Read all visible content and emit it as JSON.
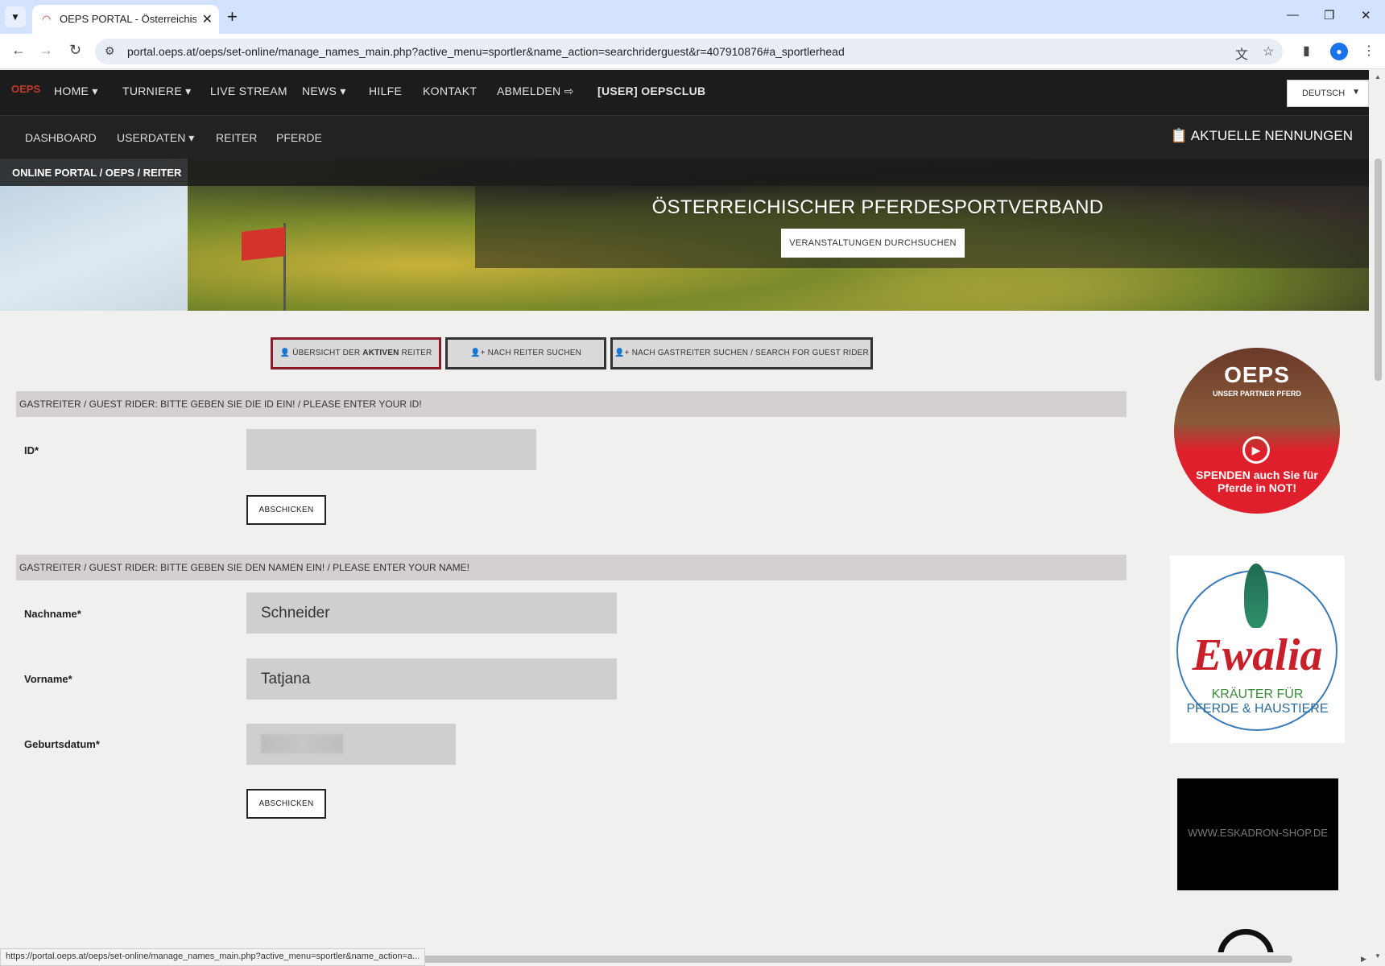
{
  "browser": {
    "tab_title": "OEPS PORTAL - Österreichische",
    "url": "portal.oeps.at/oeps/set-online/manage_names_main.php?active_menu=sportler&name_action=searchriderguest&r=407910876#a_sportlerhead",
    "status_url": "https://portal.oeps.at/oeps/set-online/manage_names_main.php?active_menu=sportler&name_action=a..."
  },
  "topnav": {
    "logo": "OEPS",
    "items": [
      "HOME ▾",
      "TURNIERE ▾",
      "LIVE STREAM",
      "NEWS ▾",
      "HILFE",
      "KONTAKT",
      "ABMELDEN ⇨",
      "[USER] OEPSCLUB"
    ],
    "language": "DEUTSCH"
  },
  "subnav": {
    "items": [
      "DASHBOARD",
      "USERDATEN ▾",
      "REITER",
      "PFERDE"
    ],
    "nennungen": "AKTUELLE NENNUNGEN"
  },
  "breadcrumb": "ONLINE PORTAL  /  OEPS  /  REITER",
  "hero": {
    "title": "ÖSTERREICHISCHER PFERDESPORTVERBAND",
    "button": "VERANSTALTUNGEN DURCHSUCHEN"
  },
  "actions": {
    "overview_prefix": "ÜBERSICHT DER ",
    "overview_bold": "AKTIVEN",
    "overview_suffix": " REITER",
    "search_rider": "NACH REITER SUCHEN",
    "search_guest": "NACH GASTREITER SUCHEN / SEARCH FOR GUEST RIDER"
  },
  "form_id": {
    "heading": "GASTREITER / GUEST RIDER: BITTE GEBEN SIE DIE ID EIN! / PLEASE ENTER YOUR ID!",
    "label": "ID*",
    "value": "",
    "submit": "ABSCHICKEN"
  },
  "form_name": {
    "heading": "GASTREITER / GUEST RIDER: BITTE GEBEN SIE DEN NAMEN EIN! / PLEASE ENTER YOUR NAME!",
    "lastname_label": "Nachname*",
    "lastname_value": "Schneider",
    "firstname_label": "Vorname*",
    "firstname_value": "Tatjana",
    "birthdate_label": "Geburtsdatum*",
    "submit": "ABSCHICKEN"
  },
  "ads": {
    "oeps_logo": "OEPS",
    "oeps_sub": "UNSER PARTNER PFERD",
    "oeps_text": "SPENDEN auch Sie für Pferde in NOT!",
    "ewalia_name": "Ewalia",
    "ewalia_sub1": "KRÄUTER FÜR",
    "ewalia_sub2": "PFERDE & HAUSTIERE",
    "eskadron": "WWW.ESKADRON-SHOP.DE"
  },
  "colors": {
    "nav_bg": "#1c1c1c",
    "active_border": "#8a1c2b",
    "section_bg": "#d5d0d0",
    "ad_red": "#e01f2c"
  }
}
